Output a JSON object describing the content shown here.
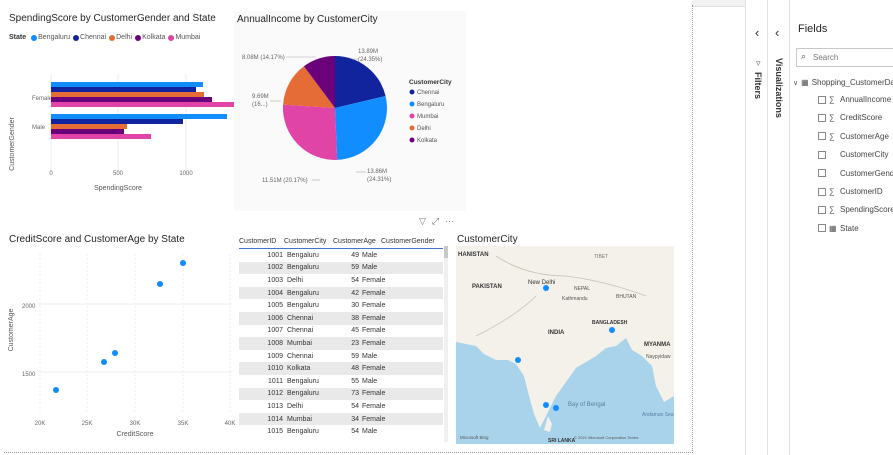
{
  "colors": {
    "Bengaluru": "#118dff",
    "Chennai": "#12239e",
    "Delhi": "#e66c37",
    "Kolkata": "#6b007b",
    "Mumbai": "#e044a7"
  },
  "bar_visual": {
    "title": "SpendingScore by CustomerGender and State",
    "legend_title": "State",
    "legend": [
      "Bengaluru",
      "Chennai",
      "Delhi",
      "Kolkata",
      "Mumbai"
    ],
    "ylabel": "CustomerGender",
    "xlabel": "SpendingScore",
    "xticks": [
      "0",
      "500",
      "1000"
    ]
  },
  "pie_visual": {
    "title": "AnnualIncome by CustomerCity",
    "legend_title": "CustomerCity",
    "legend": [
      "Chennai",
      "Bengaluru",
      "Mumbai",
      "Delhi",
      "Kolkata"
    ],
    "labels": {
      "chennai": [
        "13.89M",
        "(24.35%)"
      ],
      "bengaluru": [
        "13.86M",
        "(24.31%)"
      ],
      "mumbai": [
        "11.51M (20.17%)"
      ],
      "delhi": [
        "9.69M",
        "(16...)"
      ],
      "kolkata": [
        "8.08M (14.17%)"
      ]
    }
  },
  "scatter_visual": {
    "title": "CreditScore and CustomerAge by State",
    "ylabel": "CustomerAge",
    "xlabel": "CreditScore",
    "yticks": [
      "2000",
      "1500"
    ],
    "xticks": [
      "20K",
      "25K",
      "30K",
      "35K",
      "40K"
    ]
  },
  "table_visual": {
    "headers": [
      "CustomerID",
      "CustomerCity",
      "CustomerAge",
      "CustomerGender"
    ],
    "rows": [
      [
        "1001",
        "Bengaluru",
        "49",
        "Male"
      ],
      [
        "1002",
        "Bengaluru",
        "59",
        "Male"
      ],
      [
        "1003",
        "Delhi",
        "54",
        "Female"
      ],
      [
        "1004",
        "Bengaluru",
        "42",
        "Female"
      ],
      [
        "1005",
        "Bengaluru",
        "30",
        "Female"
      ],
      [
        "1006",
        "Chennai",
        "38",
        "Female"
      ],
      [
        "1007",
        "Chennai",
        "45",
        "Female"
      ],
      [
        "1008",
        "Mumbai",
        "23",
        "Female"
      ],
      [
        "1009",
        "Chennai",
        "59",
        "Male"
      ],
      [
        "1010",
        "Kolkata",
        "48",
        "Female"
      ],
      [
        "1011",
        "Bengaluru",
        "55",
        "Male"
      ],
      [
        "1012",
        "Bengaluru",
        "73",
        "Female"
      ],
      [
        "1013",
        "Delhi",
        "54",
        "Female"
      ],
      [
        "1014",
        "Mumbai",
        "34",
        "Female"
      ],
      [
        "1015",
        "Bengaluru",
        "54",
        "Male"
      ]
    ]
  },
  "map_visual": {
    "title": "CustomerCity",
    "labels": {
      "afghanistan": "HANISTAN",
      "pakistan": "PAKISTAN",
      "new_delhi": "New Delhi",
      "nepal": "NEPAL",
      "kathmandu": "Kathmandu",
      "bhutan": "BHUTAN",
      "tibet": "TIBET",
      "bangladesh": "BANGLADESH",
      "india": "INDIA",
      "myanmar": "MYANMA",
      "naypyidaw": "Naypyidaw",
      "bay": "Bay of Bengal",
      "andaman": "Andaman Sea",
      "srilanka": "SRI LANKA",
      "credit": "© 2021 Microsoft Corporation Terms",
      "bing": "Microsoft Bing"
    }
  },
  "visual_header": {
    "filter": "▽",
    "focus": "⤢",
    "more": "···"
  },
  "filters_pane": {
    "label": "Filters",
    "chevron": "‹"
  },
  "viz_pane": {
    "label": "Visualizations",
    "chevron": "‹"
  },
  "fields_pane": {
    "title": "Fields",
    "search_placeholder": "Search",
    "table_name": "Shopping_CustomerData",
    "fields": [
      {
        "label": "AnnualIncome",
        "sigma": true
      },
      {
        "label": "CreditScore",
        "sigma": true
      },
      {
        "label": "CustomerAge",
        "sigma": true
      },
      {
        "label": "CustomerCity",
        "sigma": false
      },
      {
        "label": "CustomerGender",
        "sigma": false
      },
      {
        "label": "CustomerID",
        "sigma": true
      },
      {
        "label": "SpendingScore",
        "sigma": true
      },
      {
        "label": "State",
        "sigma": false
      }
    ]
  }
}
